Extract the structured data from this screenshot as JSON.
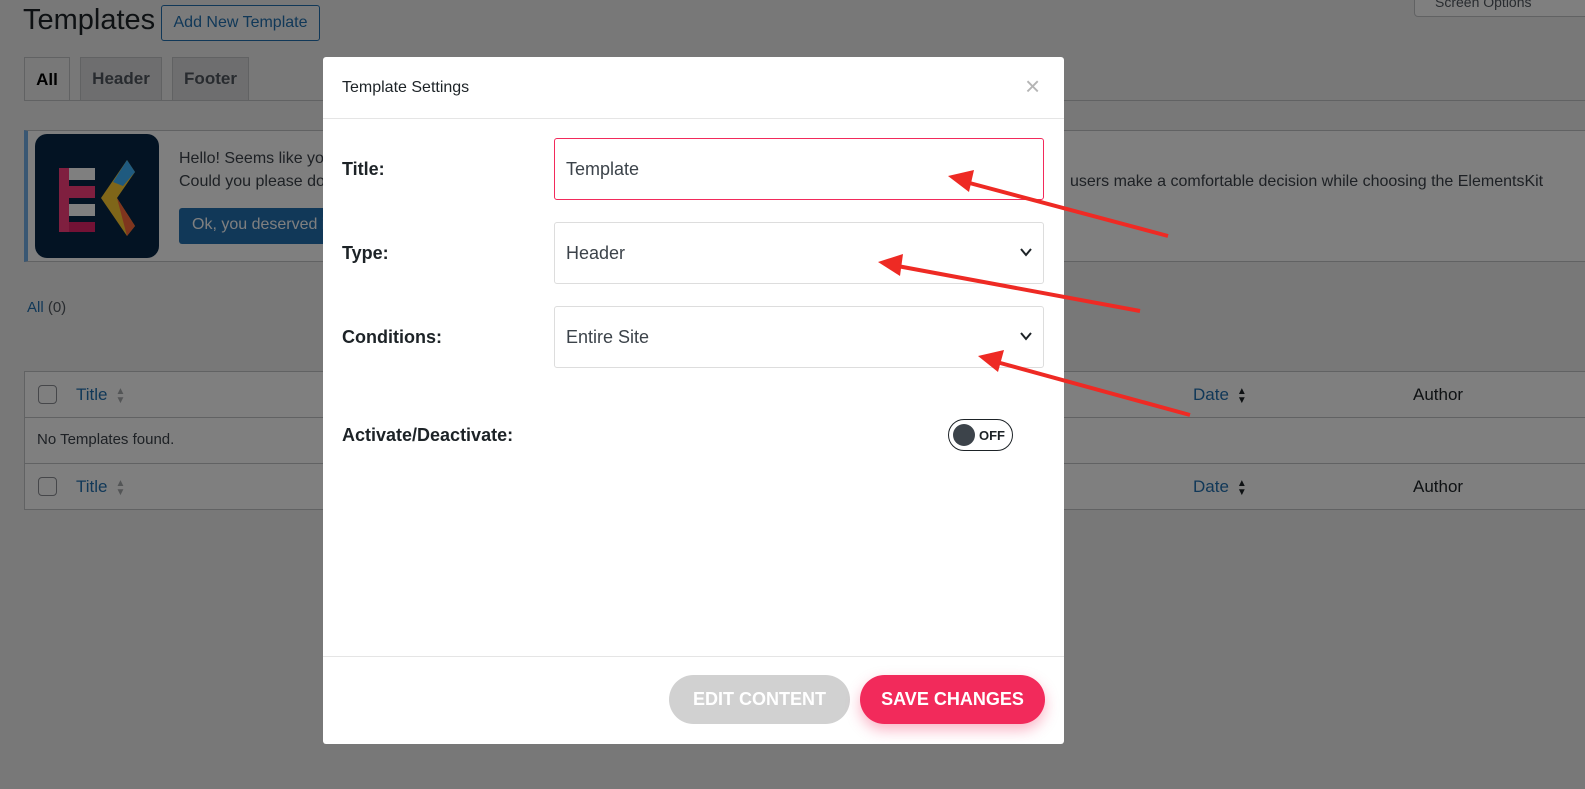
{
  "page": {
    "title": "Templates",
    "add_new_label": "Add New Template",
    "screen_options_label": "Screen Options",
    "tabs": [
      {
        "label": "All",
        "active": true
      },
      {
        "label": "Header",
        "active": false
      },
      {
        "label": "Footer",
        "active": false
      }
    ]
  },
  "notice": {
    "line1_left": "Hello! Seems like you",
    "line2_left": "Could you please do",
    "line2_right": "users make a comfortable decision while choosing the ElementsKit",
    "button_label": "Ok, you deserved it",
    "logo_icon": "elementskit-logo-icon"
  },
  "filter": {
    "all_label": "All",
    "all_count": "(0)"
  },
  "table": {
    "columns": [
      "Title",
      "Date",
      "Author"
    ],
    "empty_message": "No Templates found."
  },
  "modal": {
    "title": "Template Settings",
    "close_glyph": "×",
    "fields": {
      "title_label": "Title:",
      "title_value": "Template",
      "type_label": "Type:",
      "type_value": "Header",
      "conditions_label": "Conditions:",
      "conditions_value": "Entire Site",
      "activate_label": "Activate/Deactivate:",
      "toggle_state": "OFF"
    },
    "buttons": {
      "edit_label": "EDIT CONTENT",
      "save_label": "SAVE CHANGES"
    }
  },
  "colors": {
    "accent": "#f22a5b",
    "wp_blue": "#2271b1",
    "annotation_arrow": "#ee2a24"
  }
}
